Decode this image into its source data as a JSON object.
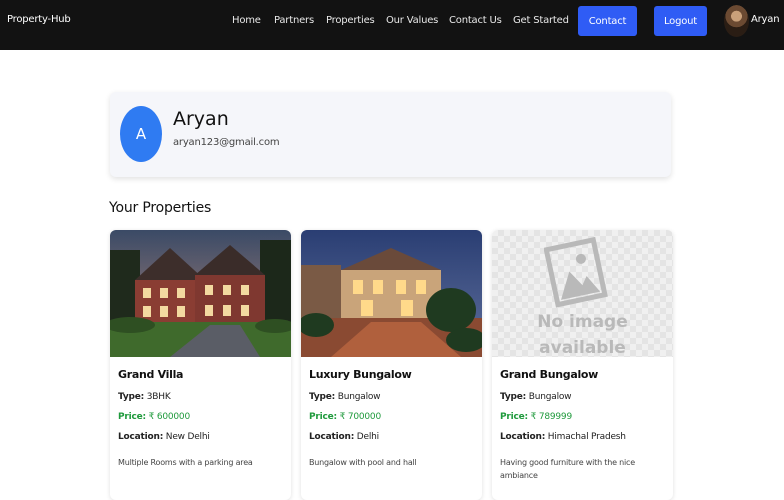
{
  "navbar": {
    "brand": "Property-Hub",
    "links": [
      "Home",
      "Partners",
      "Properties",
      "Our Values",
      "Contact Us",
      "Get Started"
    ],
    "contact_label": "Contact",
    "logout_label": "Logout",
    "user_name": "Aryan",
    "accent_color": "#2f5cf5"
  },
  "profile": {
    "initial": "A",
    "name": "Aryan",
    "email": "aryan123@gmail.com"
  },
  "section_title": "Your Properties",
  "labels": {
    "type": "Type:",
    "price": "Price:",
    "location": "Location:"
  },
  "properties": [
    {
      "title": "Grand Villa",
      "type": "3BHK",
      "price": "₹ 600000",
      "location": "New Delhi",
      "description": "Multiple Rooms with a parking area",
      "image": "house-photo"
    },
    {
      "title": "Luxury Bungalow",
      "type": "Bungalow",
      "price": "₹ 700000",
      "location": "Delhi",
      "description": "Bungalow with pool and hall",
      "image": "bungalow-photo"
    },
    {
      "title": "Grand Bungalow",
      "type": "Bungalow",
      "price": "₹ 789999",
      "location": "Himachal Pradesh",
      "description": "Having good furniture with the nice ambiance",
      "image": "no-image-placeholder",
      "placeholder_line1": "No image",
      "placeholder_line2": "available"
    }
  ],
  "price_color": "#1f9a3c"
}
